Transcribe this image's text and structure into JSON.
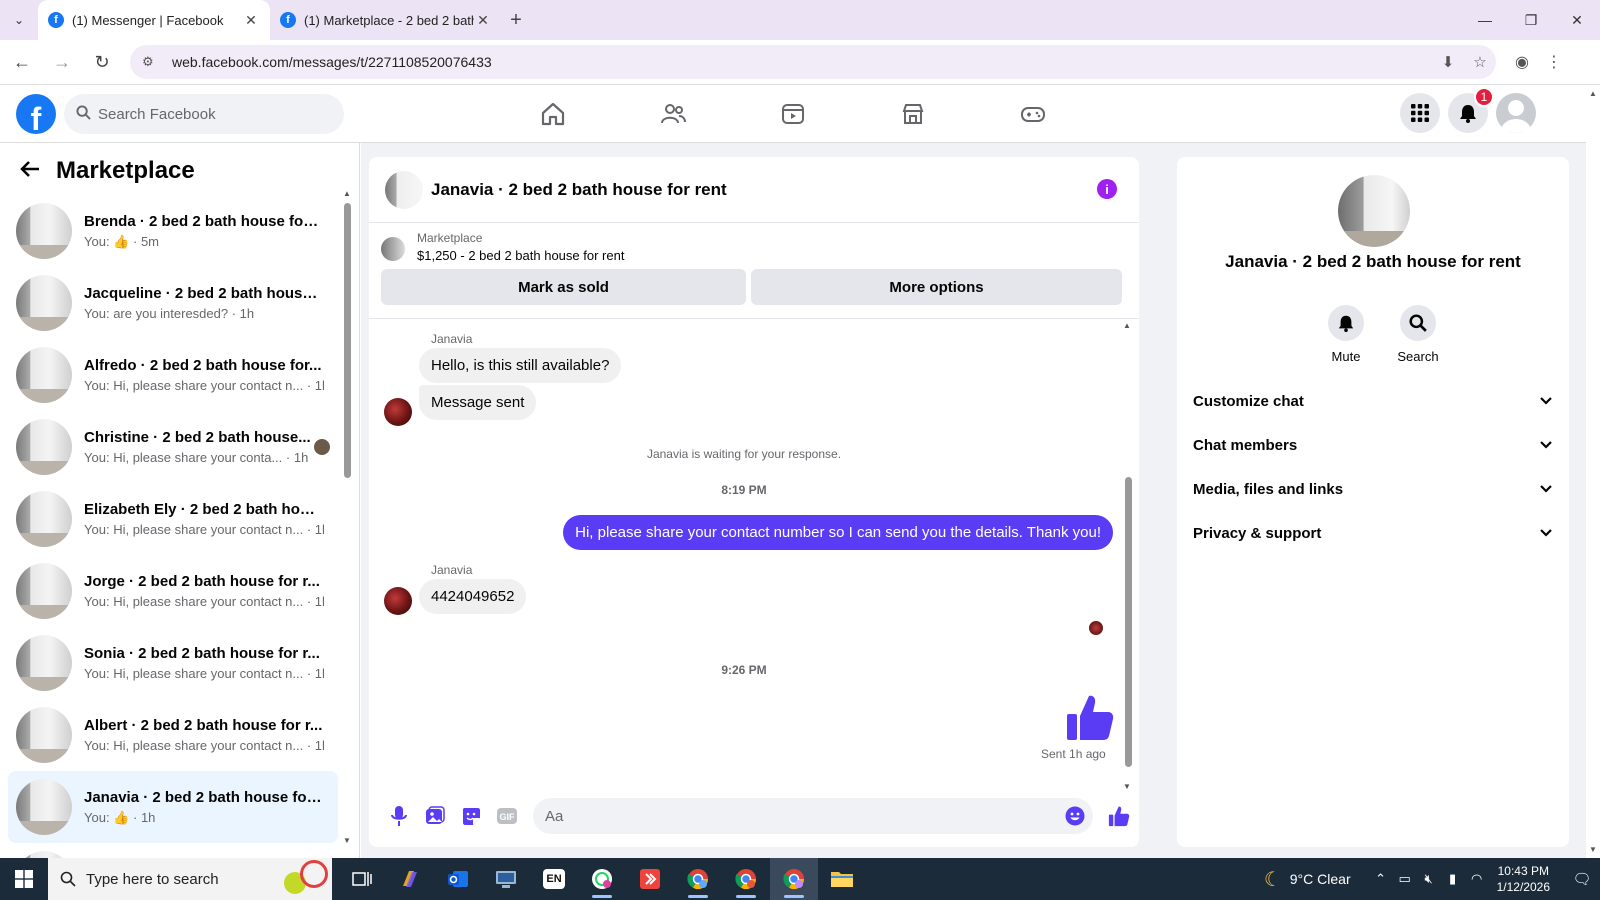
{
  "browser": {
    "tabs": [
      {
        "label": "(1) Messenger | Facebook",
        "active": true
      },
      {
        "label": "(1) Marketplace - 2 bed 2 bath",
        "active": false
      }
    ],
    "url": "web.facebook.com/messages/t/2271108520076433"
  },
  "fb": {
    "search_placeholder": "Search Facebook",
    "notification_count": "1",
    "brand_color": "#1877f2"
  },
  "left": {
    "title": "Marketplace",
    "conversations": [
      {
        "name": "Brenda · 2 bed 2 bath house for ...",
        "preview_prefix": "You:",
        "preview": "",
        "time": "5m",
        "thumb": true
      },
      {
        "name": "Jacqueline · 2 bed 2 bath house ...",
        "preview_prefix": "You:",
        "preview": "are you interesded?",
        "time": "1h"
      },
      {
        "name": "Alfredo · 2 bed 2 bath house for...",
        "preview_prefix": "You:",
        "preview": "Hi, please share your contact n...",
        "time": "1h"
      },
      {
        "name": "Christine · 2 bed 2 bath house...",
        "preview_prefix": "You:",
        "preview": "Hi, please share your conta...",
        "time": "1h"
      },
      {
        "name": "Elizabeth Ely · 2 bed 2 bath hous...",
        "preview_prefix": "You:",
        "preview": "Hi, please share your contact n...",
        "time": "1h"
      },
      {
        "name": "Jorge · 2 bed 2 bath house for r...",
        "preview_prefix": "You:",
        "preview": "Hi, please share your contact n...",
        "time": "1h"
      },
      {
        "name": "Sonia · 2 bed 2 bath house for r...",
        "preview_prefix": "You:",
        "preview": "Hi, please share your contact n...",
        "time": "1h"
      },
      {
        "name": "Albert · 2 bed 2 bath house for r...",
        "preview_prefix": "You:",
        "preview": "Hi, please share your contact n...",
        "time": "1h"
      },
      {
        "name": "Janavia · 2 bed 2 bath house for ...",
        "preview_prefix": "You:",
        "preview": "",
        "time": "1h",
        "thumb": true,
        "selected": true
      }
    ]
  },
  "chat": {
    "title": "Janavia · 2 bed 2 bath house for rent",
    "listing": {
      "source": "Marketplace",
      "title": "$1,250 - 2 bed 2 bath house for rent",
      "mark_sold": "Mark as sold",
      "more_options": "More options"
    },
    "messages": {
      "sender1": "Janavia",
      "m1": "Hello, is this still available?",
      "m2": "Message sent",
      "system": "Janavia is waiting for your response.",
      "time1": "8:19 PM",
      "out1": "Hi, please share your contact number so I can send you the details. Thank you!",
      "sender2": "Janavia",
      "m3": "4424049652",
      "time2": "9:26 PM",
      "sent_status": "Sent 1h ago"
    },
    "composer_placeholder": "Aa",
    "accent": "#5b3cf5"
  },
  "info": {
    "name": "Janavia · 2 bed 2 bath house for rent",
    "actions": [
      {
        "label": "Mute",
        "icon": "bell-icon"
      },
      {
        "label": "Search",
        "icon": "search-icon"
      }
    ],
    "sections": [
      "Customize chat",
      "Chat members",
      "Media, files and links",
      "Privacy & support"
    ]
  },
  "taskbar": {
    "search_placeholder": "Type here to search",
    "weather": "9°C  Clear",
    "time": "10:43 PM",
    "date": "1/12/2026",
    "lang": "EN"
  }
}
